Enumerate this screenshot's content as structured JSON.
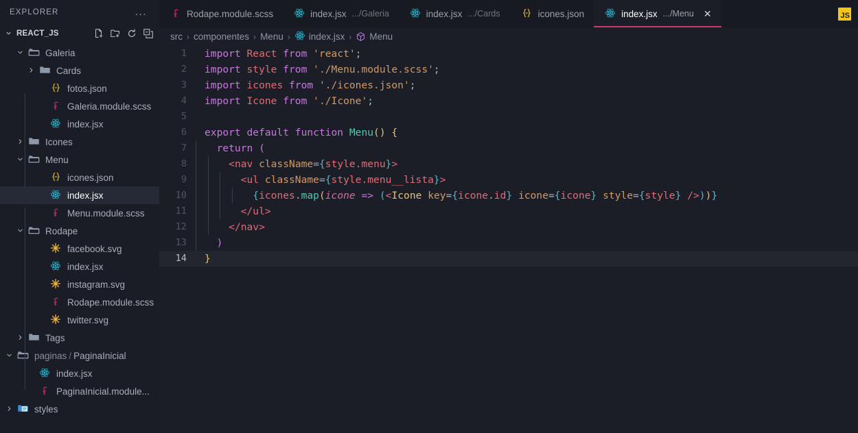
{
  "sidebar": {
    "explorer_label": "EXPLORER",
    "more_actions_label": "...",
    "project_name": "REACT_JS",
    "actions": [
      {
        "name": "new-file-icon",
        "label": "New File"
      },
      {
        "name": "new-folder-icon",
        "label": "New Folder"
      },
      {
        "name": "refresh-icon",
        "label": "Refresh Explorer"
      },
      {
        "name": "collapse-all-icon",
        "label": "Collapse Folders in Explorer"
      }
    ],
    "tree": [
      {
        "label": "Galeria",
        "icon": "folder-open",
        "chev": "down",
        "depth": 1,
        "selected": false
      },
      {
        "label": "Cards",
        "icon": "folder-closed",
        "chev": "right",
        "depth": 2,
        "selected": false
      },
      {
        "label": "fotos.json",
        "icon": "json",
        "chev": "none",
        "depth": 3,
        "selected": false
      },
      {
        "label": "Galeria.module.scss",
        "icon": "scss",
        "chev": "none",
        "depth": 3,
        "selected": false
      },
      {
        "label": "index.jsx",
        "icon": "react",
        "chev": "none",
        "depth": 3,
        "selected": false
      },
      {
        "label": "Icones",
        "icon": "folder-closed",
        "chev": "right",
        "depth": 1,
        "selected": false
      },
      {
        "label": "Menu",
        "icon": "folder-open",
        "chev": "down",
        "depth": 1,
        "selected": false
      },
      {
        "label": "icones.json",
        "icon": "json",
        "chev": "none",
        "depth": 3,
        "selected": false
      },
      {
        "label": "index.jsx",
        "icon": "react",
        "chev": "none",
        "depth": 3,
        "selected": true
      },
      {
        "label": "Menu.module.scss",
        "icon": "scss",
        "chev": "none",
        "depth": 3,
        "selected": false
      },
      {
        "label": "Rodape",
        "icon": "folder-open",
        "chev": "down",
        "depth": 1,
        "selected": false
      },
      {
        "label": "facebook.svg",
        "icon": "svg",
        "chev": "none",
        "depth": 3,
        "selected": false
      },
      {
        "label": "index.jsx",
        "icon": "react",
        "chev": "none",
        "depth": 3,
        "selected": false
      },
      {
        "label": "instagram.svg",
        "icon": "svg",
        "chev": "none",
        "depth": 3,
        "selected": false
      },
      {
        "label": "Rodape.module.scss",
        "icon": "scss",
        "chev": "none",
        "depth": 3,
        "selected": false
      },
      {
        "label": "twitter.svg",
        "icon": "svg",
        "chev": "none",
        "depth": 3,
        "selected": false
      },
      {
        "label": "Tags",
        "icon": "folder-closed",
        "chev": "right",
        "depth": 1,
        "selected": false
      },
      {
        "label": "paginas / PaginaInicial",
        "icon": "folder-open",
        "chev": "down",
        "depth": 0,
        "selected": false
      },
      {
        "label": "index.jsx",
        "icon": "react",
        "chev": "none",
        "depth": 2,
        "selected": false
      },
      {
        "label": "PaginaInicial.module...",
        "icon": "scss",
        "chev": "none",
        "depth": 2,
        "selected": false
      },
      {
        "label": "styles",
        "icon": "folder-styles",
        "chev": "right",
        "depth": 0,
        "selected": false
      }
    ]
  },
  "tabs": [
    {
      "name": "Rodape.module.scss",
      "path": "",
      "icon": "scss",
      "active": false
    },
    {
      "name": "index.jsx",
      "path": ".../Galeria",
      "icon": "react",
      "active": false
    },
    {
      "name": "index.jsx",
      "path": ".../Cards",
      "icon": "react",
      "active": false
    },
    {
      "name": "icones.json",
      "path": "",
      "icon": "json",
      "active": false
    },
    {
      "name": "index.jsx",
      "path": ".../Menu",
      "icon": "react",
      "active": true,
      "close_label": "✕"
    }
  ],
  "tabbar": {
    "js_badge_label": "JS"
  },
  "breadcrumb": [
    {
      "label": "src",
      "icon": "none"
    },
    {
      "label": "componentes",
      "icon": "none"
    },
    {
      "label": "Menu",
      "icon": "none"
    },
    {
      "label": "index.jsx",
      "icon": "react"
    },
    {
      "label": "Menu",
      "icon": "symbol-cube"
    }
  ],
  "editor": {
    "current_line": 14,
    "lines": [
      {
        "n": 1,
        "guides": 0,
        "tokens": [
          {
            "t": "import ",
            "c": "kw"
          },
          {
            "t": "React",
            "c": "id"
          },
          {
            "t": " from ",
            "c": "kw"
          },
          {
            "t": "'react'",
            "c": "str"
          },
          {
            "t": ";",
            "c": "plain"
          }
        ]
      },
      {
        "n": 2,
        "guides": 0,
        "tokens": [
          {
            "t": "import ",
            "c": "kw"
          },
          {
            "t": "style",
            "c": "id"
          },
          {
            "t": " from ",
            "c": "kw"
          },
          {
            "t": "'./Menu.module.scss'",
            "c": "str"
          },
          {
            "t": ";",
            "c": "plain"
          }
        ]
      },
      {
        "n": 3,
        "guides": 0,
        "tokens": [
          {
            "t": "import ",
            "c": "kw"
          },
          {
            "t": "icones",
            "c": "id"
          },
          {
            "t": " from ",
            "c": "kw"
          },
          {
            "t": "'./icones.json'",
            "c": "str"
          },
          {
            "t": ";",
            "c": "plain"
          }
        ]
      },
      {
        "n": 4,
        "guides": 0,
        "tokens": [
          {
            "t": "import ",
            "c": "kw"
          },
          {
            "t": "Icone",
            "c": "id"
          },
          {
            "t": " from ",
            "c": "kw"
          },
          {
            "t": "'./Icone'",
            "c": "str"
          },
          {
            "t": ";",
            "c": "plain"
          }
        ]
      },
      {
        "n": 5,
        "guides": 0,
        "tokens": []
      },
      {
        "n": 6,
        "guides": 0,
        "tokens": [
          {
            "t": "export default function ",
            "c": "kw"
          },
          {
            "t": "Menu",
            "c": "fn"
          },
          {
            "t": "()",
            "c": "yel"
          },
          {
            "t": " ",
            "c": "plain"
          },
          {
            "t": "{",
            "c": "yel"
          }
        ]
      },
      {
        "n": 7,
        "guides": 1,
        "tokens": [
          {
            "t": "  ",
            "c": "plain"
          },
          {
            "t": "return",
            "c": "kw"
          },
          {
            "t": " ",
            "c": "plain"
          },
          {
            "t": "(",
            "c": "pur"
          }
        ]
      },
      {
        "n": 8,
        "guides": 2,
        "tokens": [
          {
            "t": "    ",
            "c": "plain"
          },
          {
            "t": "<nav",
            "c": "tag"
          },
          {
            "t": " ",
            "c": "plain"
          },
          {
            "t": "className",
            "c": "attr"
          },
          {
            "t": "=",
            "c": "plain"
          },
          {
            "t": "{",
            "c": "brc"
          },
          {
            "t": "style.menu",
            "c": "id"
          },
          {
            "t": "}",
            "c": "brc"
          },
          {
            "t": ">",
            "c": "tag"
          }
        ]
      },
      {
        "n": 9,
        "guides": 3,
        "tokens": [
          {
            "t": "      ",
            "c": "plain"
          },
          {
            "t": "<ul",
            "c": "tag"
          },
          {
            "t": " ",
            "c": "plain"
          },
          {
            "t": "className",
            "c": "attr"
          },
          {
            "t": "=",
            "c": "plain"
          },
          {
            "t": "{",
            "c": "brc"
          },
          {
            "t": "style.menu__lista",
            "c": "id"
          },
          {
            "t": "}",
            "c": "brc"
          },
          {
            "t": ">",
            "c": "tag"
          }
        ]
      },
      {
        "n": 10,
        "guides": 4,
        "tokens": [
          {
            "t": "        ",
            "c": "plain"
          },
          {
            "t": "{",
            "c": "brc"
          },
          {
            "t": "icones",
            "c": "id"
          },
          {
            "t": ".",
            "c": "plain"
          },
          {
            "t": "map",
            "c": "fn"
          },
          {
            "t": "(",
            "c": "yel"
          },
          {
            "t": "icone",
            "c": "ital"
          },
          {
            "t": " ",
            "c": "plain"
          },
          {
            "t": "=>",
            "c": "pur"
          },
          {
            "t": " ",
            "c": "plain"
          },
          {
            "t": "(",
            "c": "brc"
          },
          {
            "t": "<",
            "c": "tag"
          },
          {
            "t": "Icone",
            "c": "comp"
          },
          {
            "t": " ",
            "c": "plain"
          },
          {
            "t": "key",
            "c": "attr"
          },
          {
            "t": "=",
            "c": "plain"
          },
          {
            "t": "{",
            "c": "brc"
          },
          {
            "t": "icone",
            "c": "id"
          },
          {
            "t": ".",
            "c": "plain"
          },
          {
            "t": "id",
            "c": "id"
          },
          {
            "t": "}",
            "c": "brc"
          },
          {
            "t": " ",
            "c": "plain"
          },
          {
            "t": "icone",
            "c": "attr"
          },
          {
            "t": "=",
            "c": "plain"
          },
          {
            "t": "{",
            "c": "brc"
          },
          {
            "t": "icone",
            "c": "id"
          },
          {
            "t": "}",
            "c": "brc"
          },
          {
            "t": " ",
            "c": "plain"
          },
          {
            "t": "style",
            "c": "attr"
          },
          {
            "t": "=",
            "c": "plain"
          },
          {
            "t": "{",
            "c": "brc"
          },
          {
            "t": "style",
            "c": "id"
          },
          {
            "t": "}",
            "c": "brc"
          },
          {
            "t": " ",
            "c": "plain"
          },
          {
            "t": "/>",
            "c": "tag"
          },
          {
            "t": ")",
            "c": "brc"
          },
          {
            "t": ")",
            "c": "yel"
          },
          {
            "t": "}",
            "c": "brc"
          }
        ]
      },
      {
        "n": 11,
        "guides": 3,
        "tokens": [
          {
            "t": "      ",
            "c": "plain"
          },
          {
            "t": "</ul>",
            "c": "tag"
          }
        ]
      },
      {
        "n": 12,
        "guides": 2,
        "tokens": [
          {
            "t": "    ",
            "c": "plain"
          },
          {
            "t": "</nav>",
            "c": "tag"
          }
        ]
      },
      {
        "n": 13,
        "guides": 1,
        "tokens": [
          {
            "t": "  ",
            "c": "plain"
          },
          {
            "t": ")",
            "c": "pur"
          }
        ]
      },
      {
        "n": 14,
        "guides": 0,
        "tokens": [
          {
            "t": "}",
            "c": "yel"
          }
        ]
      }
    ]
  },
  "colors": {
    "background": "#1b1e26",
    "sidebar_background": "#1a1d25",
    "tabbar_background": "#171a21",
    "active_tab_underline": "#d13a68",
    "selection": "#262a36",
    "current_line": "#24262e",
    "react_icon": "#1fc2e0",
    "scss_icon": "#e0267a",
    "json_icon": "#e8c547",
    "svg_icon": "#f5b731",
    "js_badge": "#f5c518"
  }
}
